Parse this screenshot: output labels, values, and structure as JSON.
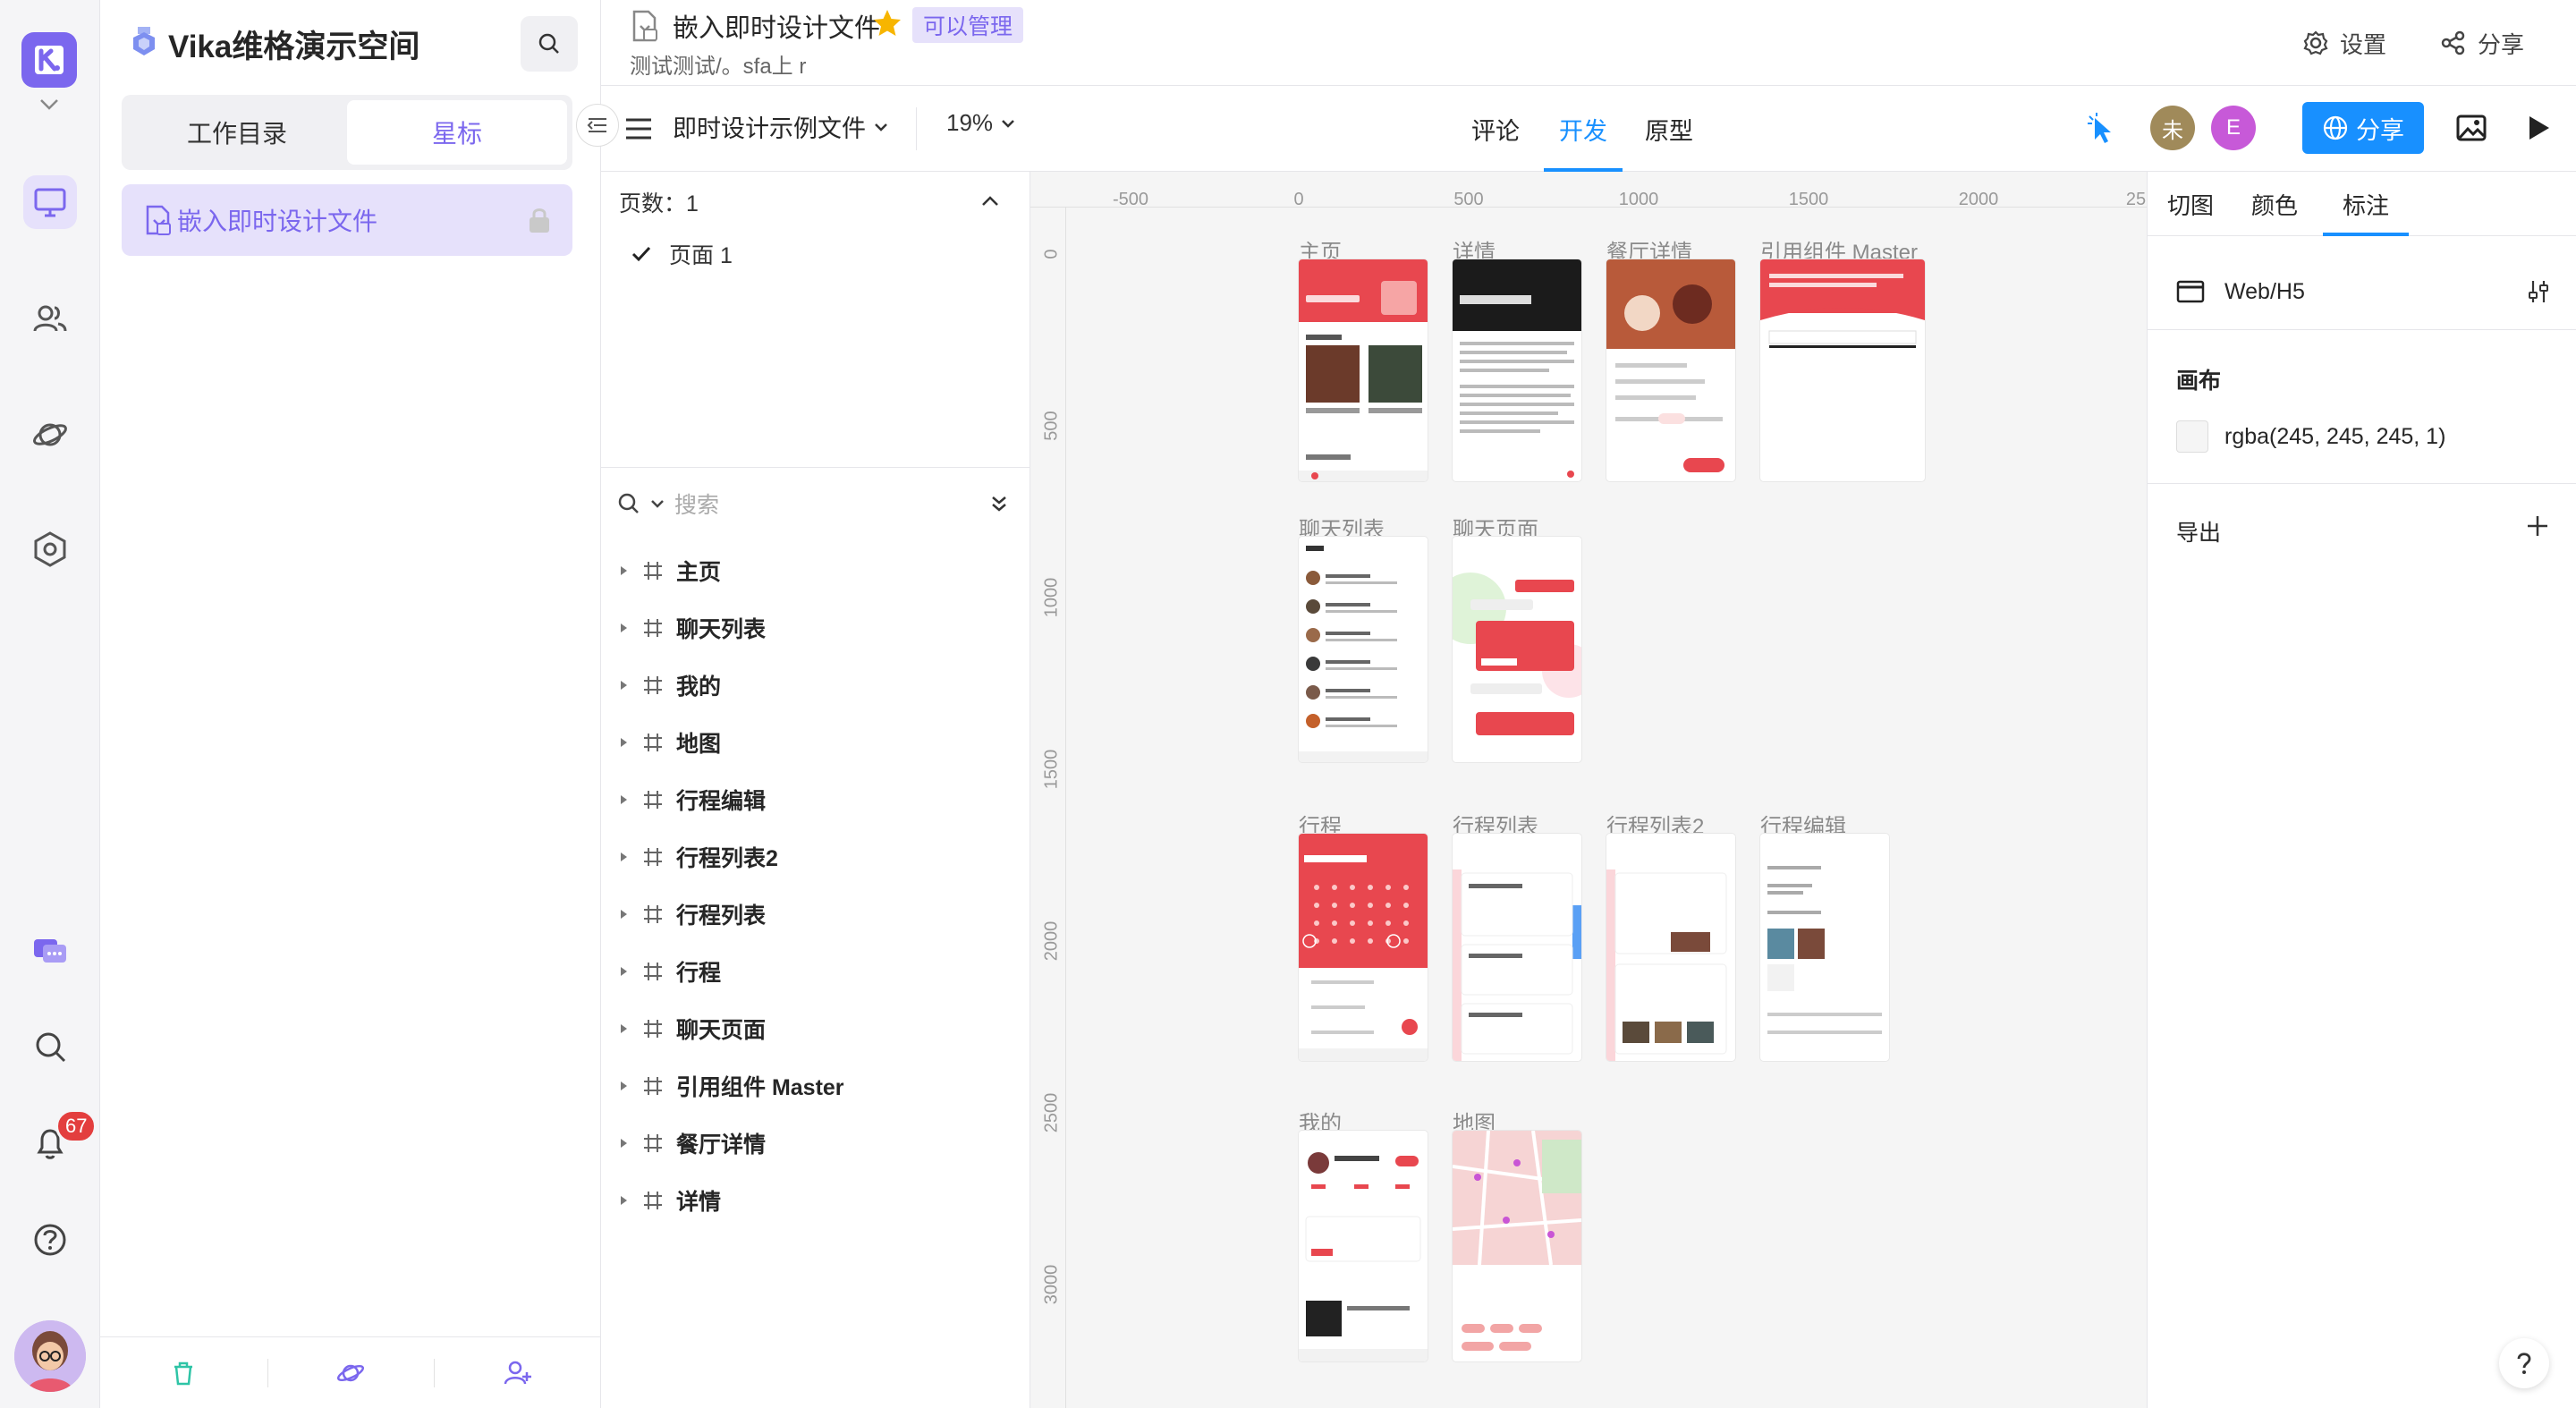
{
  "workspace": {
    "title": "Vika维格演示空间",
    "tabs": [
      "工作目录",
      "星标"
    ],
    "file": "嵌入即时设计文件",
    "notifications": "67"
  },
  "doc": {
    "title": "嵌入即时设计文件",
    "permission": "可以管理",
    "description": "测试测试/。sfa上 r",
    "settings": "设置",
    "share": "分享"
  },
  "toolbar": {
    "file": "即时设计示例文件",
    "zoom": "19%",
    "tabs": [
      "评论",
      "开发",
      "原型"
    ],
    "avatars": [
      "未",
      "E"
    ],
    "share": "分享"
  },
  "layers": {
    "pages_heading": "页数：1",
    "page": "页面 1",
    "search_placeholder": "搜索",
    "items": [
      "主页",
      "聊天列表",
      "我的",
      "地图",
      "行程编辑",
      "行程列表2",
      "行程列表",
      "行程",
      "聊天页面",
      "引用组件 Master",
      "餐厅详情",
      "详情"
    ]
  },
  "canvas": {
    "ruler_x": [
      "-500",
      "0",
      "500",
      "1000",
      "1500",
      "2000",
      "25"
    ],
    "ruler_y": [
      "0",
      "500",
      "1000",
      "1500",
      "2000",
      "2500",
      "3000"
    ],
    "artboards": [
      "主页",
      "详情",
      "餐厅详情",
      "引用组件 Master",
      "聊天列表",
      "聊天页面",
      "行程",
      "行程列表",
      "行程列表2",
      "行程编辑",
      "我的",
      "地图"
    ],
    "accent": "#e8474f"
  },
  "inspector": {
    "tabs": [
      "切图",
      "颜色",
      "标注"
    ],
    "platform": "Web/H5",
    "canvas_heading": "画布",
    "canvas_color": "rgba(245, 245, 245, 1)",
    "export_heading": "导出"
  },
  "colors": {
    "brand": "#7b67ee",
    "primary": "#1890ff"
  }
}
